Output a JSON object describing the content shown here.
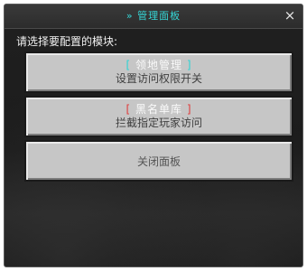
{
  "dialog": {
    "title": "» 管理面板",
    "close_icon": "×",
    "prompt": "请选择要配置的模块:"
  },
  "buttons": [
    {
      "bracket_open": "[",
      "title": "领地管理",
      "bracket_close": "]",
      "subtitle": "设置访问权限开关",
      "bracket_color": "#2bd4d4"
    },
    {
      "bracket_open": "[",
      "title": "黑名单库",
      "bracket_close": "]",
      "subtitle": "拦截指定玩家访问",
      "bracket_color": "#e03a3a"
    },
    {
      "label": "关闭面板"
    }
  ],
  "colors": {
    "title": "#35d6d6",
    "button_face": "#c6c6c6",
    "background": "#1c1c1c"
  }
}
